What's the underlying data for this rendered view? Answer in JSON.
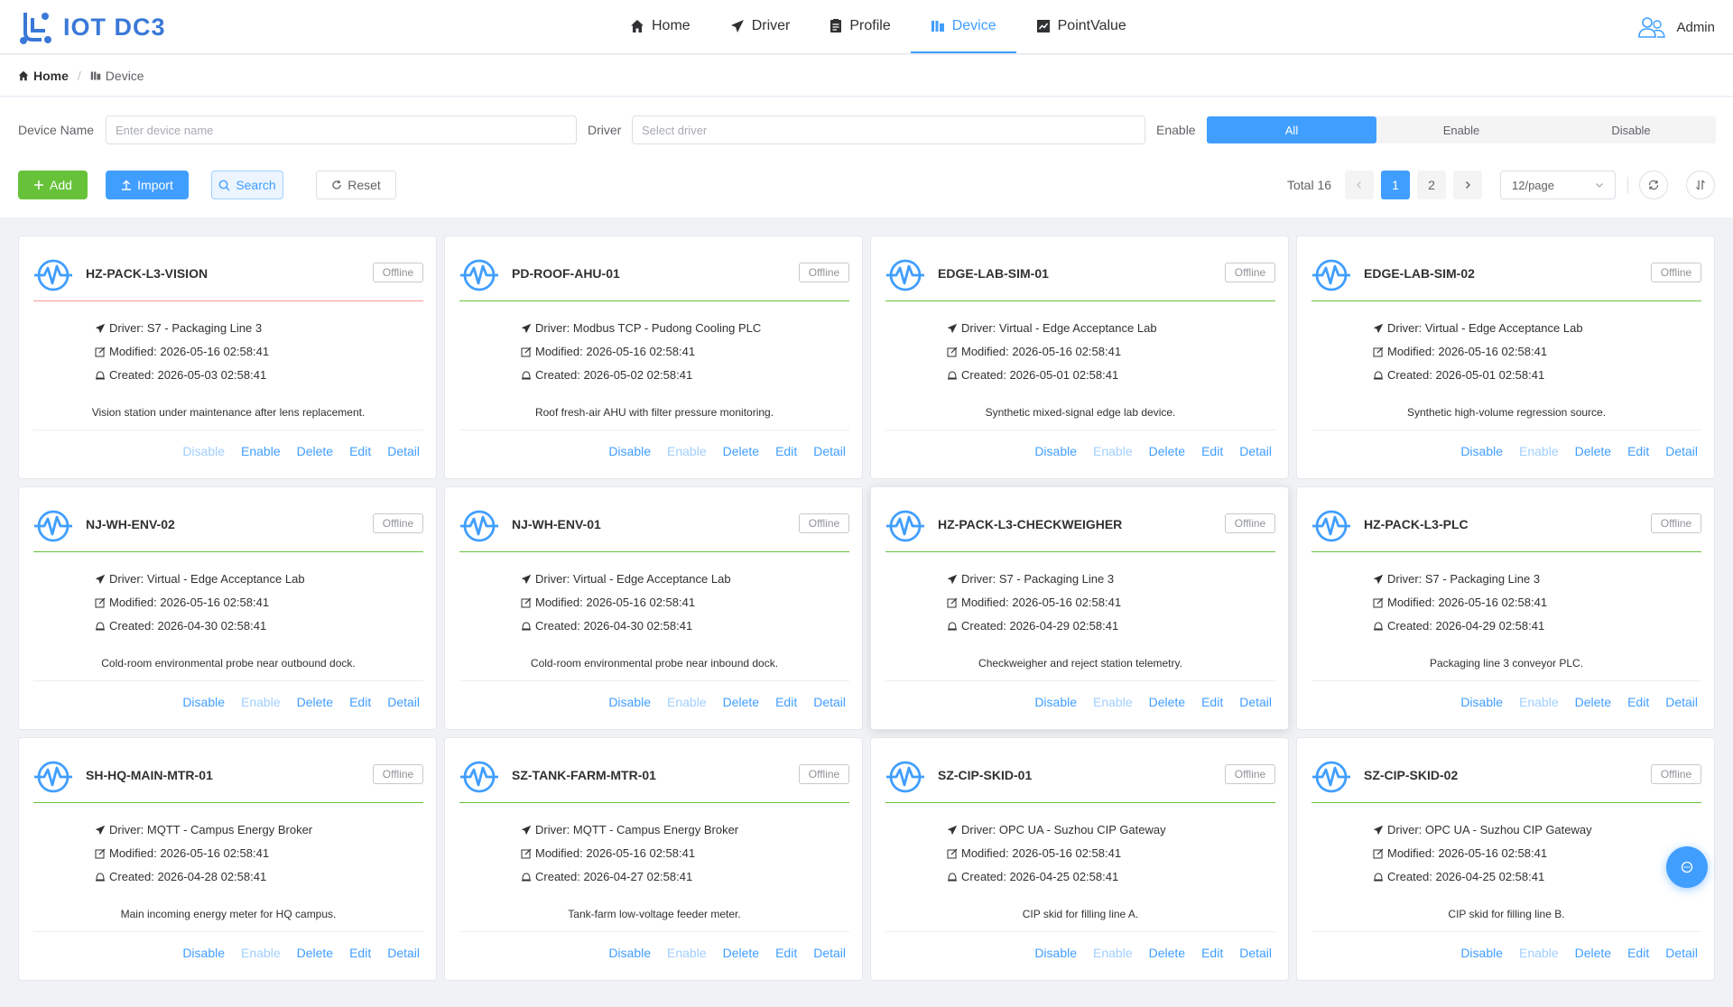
{
  "header": {
    "logo_text": "IOT DC3",
    "nav": [
      {
        "label": "Home",
        "icon": "home-icon"
      },
      {
        "label": "Driver",
        "icon": "send-icon"
      },
      {
        "label": "Profile",
        "icon": "document-icon"
      },
      {
        "label": "Device",
        "icon": "device-icon",
        "active": true
      },
      {
        "label": "PointValue",
        "icon": "chart-icon"
      }
    ],
    "user": "Admin"
  },
  "breadcrumb": {
    "home": "Home",
    "current": "Device"
  },
  "filters": {
    "device_name_label": "Device Name",
    "device_name_placeholder": "Enter device name",
    "driver_label": "Driver",
    "driver_placeholder": "Select driver",
    "enable_label": "Enable",
    "enable_options": [
      "All",
      "Enable",
      "Disable"
    ],
    "enable_selected": "All"
  },
  "toolbar": {
    "add": "Add",
    "import": "Import",
    "search": "Search",
    "reset": "Reset",
    "total": "Total 16",
    "pages": [
      "1",
      "2"
    ],
    "current_page": "1",
    "page_size": "12/page"
  },
  "colors": {
    "primary": "#409eff",
    "success": "#67c23a",
    "danger_light": "#f89898"
  },
  "cards": [
    {
      "name": "HZ-PACK-L3-VISION",
      "status": "Offline",
      "driver": "Driver: S7 - Packaging Line 3",
      "modified": "Modified: 2026-05-16 02:58:41",
      "created": "Created: 2026-05-03 02:58:41",
      "description": "Vision station under maintenance after lens replacement.",
      "enabled": false
    },
    {
      "name": "PD-ROOF-AHU-01",
      "status": "Offline",
      "driver": "Driver: Modbus TCP - Pudong Cooling PLC",
      "modified": "Modified: 2026-05-16 02:58:41",
      "created": "Created: 2026-05-02 02:58:41",
      "description": "Roof fresh-air AHU with filter pressure monitoring.",
      "enabled": true
    },
    {
      "name": "EDGE-LAB-SIM-01",
      "status": "Offline",
      "driver": "Driver: Virtual - Edge Acceptance Lab",
      "modified": "Modified: 2026-05-16 02:58:41",
      "created": "Created: 2026-05-01 02:58:41",
      "description": "Synthetic mixed-signal edge lab device.",
      "enabled": true
    },
    {
      "name": "EDGE-LAB-SIM-02",
      "status": "Offline",
      "driver": "Driver: Virtual - Edge Acceptance Lab",
      "modified": "Modified: 2026-05-16 02:58:41",
      "created": "Created: 2026-05-01 02:58:41",
      "description": "Synthetic high-volume regression source.",
      "enabled": true
    },
    {
      "name": "NJ-WH-ENV-02",
      "status": "Offline",
      "driver": "Driver: Virtual - Edge Acceptance Lab",
      "modified": "Modified: 2026-05-16 02:58:41",
      "created": "Created: 2026-04-30 02:58:41",
      "description": "Cold-room environmental probe near outbound dock.",
      "enabled": true
    },
    {
      "name": "NJ-WH-ENV-01",
      "status": "Offline",
      "driver": "Driver: Virtual - Edge Acceptance Lab",
      "modified": "Modified: 2026-05-16 02:58:41",
      "created": "Created: 2026-04-30 02:58:41",
      "description": "Cold-room environmental probe near inbound dock.",
      "enabled": true
    },
    {
      "name": "HZ-PACK-L3-CHECKWEIGHER",
      "status": "Offline",
      "driver": "Driver: S7 - Packaging Line 3",
      "modified": "Modified: 2026-05-16 02:58:41",
      "created": "Created: 2026-04-29 02:58:41",
      "description": "Checkweigher and reject station telemetry.",
      "enabled": true
    },
    {
      "name": "HZ-PACK-L3-PLC",
      "status": "Offline",
      "driver": "Driver: S7 - Packaging Line 3",
      "modified": "Modified: 2026-05-16 02:58:41",
      "created": "Created: 2026-04-29 02:58:41",
      "description": "Packaging line 3 conveyor PLC.",
      "enabled": true
    },
    {
      "name": "SH-HQ-MAIN-MTR-01",
      "status": "Offline",
      "driver": "Driver: MQTT - Campus Energy Broker",
      "modified": "Modified: 2026-05-16 02:58:41",
      "created": "Created: 2026-04-28 02:58:41",
      "description": "Main incoming energy meter for HQ campus.",
      "enabled": true
    },
    {
      "name": "SZ-TANK-FARM-MTR-01",
      "status": "Offline",
      "driver": "Driver: MQTT - Campus Energy Broker",
      "modified": "Modified: 2026-05-16 02:58:41",
      "created": "Created: 2026-04-27 02:58:41",
      "description": "Tank-farm low-voltage feeder meter.",
      "enabled": true
    },
    {
      "name": "SZ-CIP-SKID-01",
      "status": "Offline",
      "driver": "Driver: OPC UA - Suzhou CIP Gateway",
      "modified": "Modified: 2026-05-16 02:58:41",
      "created": "Created: 2026-04-25 02:58:41",
      "description": "CIP skid for filling line A.",
      "enabled": true
    },
    {
      "name": "SZ-CIP-SKID-02",
      "status": "Offline",
      "driver": "Driver: OPC UA - Suzhou CIP Gateway",
      "modified": "Modified: 2026-05-16 02:58:41",
      "created": "Created: 2026-04-25 02:58:41",
      "description": "CIP skid for filling line B.",
      "enabled": true
    }
  ],
  "card_actions": {
    "disable": "Disable",
    "enable": "Enable",
    "delete": "Delete",
    "edit": "Edit",
    "detail": "Detail"
  }
}
